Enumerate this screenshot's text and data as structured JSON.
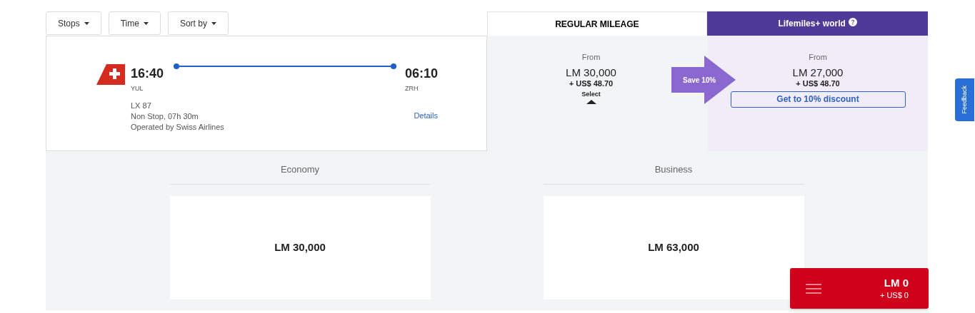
{
  "filters": [
    {
      "label": "Stops"
    },
    {
      "label": "Time"
    },
    {
      "label": "Sort by"
    }
  ],
  "tabs": [
    {
      "label": "REGULAR MILEAGE",
      "selected": true,
      "help": false
    },
    {
      "label": "Lifemiles+ world",
      "selected": false,
      "help": true
    }
  ],
  "flight": {
    "depart_time": "16:40",
    "depart_code": "YUL",
    "arrive_time": "06:10",
    "arrive_code": "ZRH",
    "flight_number": "LX 87",
    "duration": "Non Stop, 07h 30m",
    "operated_by": "Operated by Swiss Airlines",
    "details_link": "Details"
  },
  "regular": {
    "from_label": "From",
    "miles": "LM 30,000",
    "taxes": "+ US$ 48.70",
    "select_label": "Select"
  },
  "save_badge": "Save 10%",
  "lifemiles": {
    "from_label": "From",
    "miles": "LM 27,000",
    "taxes": "+ US$ 48.70",
    "button": "Get to 10% discount"
  },
  "cabins": [
    {
      "label": "Economy",
      "price": "LM 30,000"
    },
    {
      "label": "Business",
      "price": "LM 63,000"
    }
  ],
  "cart": {
    "miles": "LM 0",
    "taxes": "+ US$ 0"
  },
  "feedback": "Feedback"
}
